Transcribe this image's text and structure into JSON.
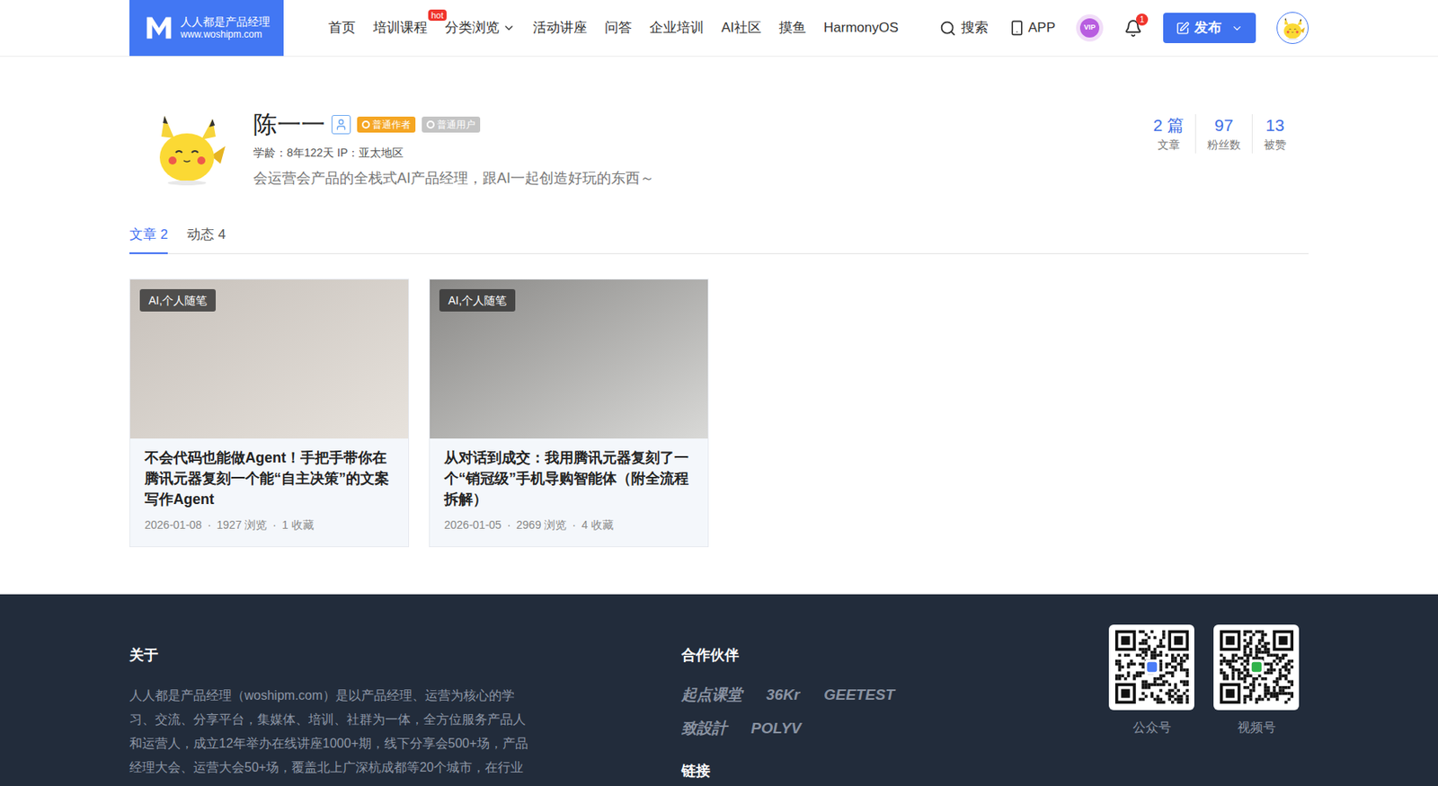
{
  "header": {
    "logo": {
      "title": "人人都是产品经理",
      "url": "www.woshipm.com"
    },
    "nav": [
      {
        "label": "首页",
        "badge": "",
        "dropdown": false
      },
      {
        "label": "培训课程",
        "badge": "hot",
        "dropdown": false
      },
      {
        "label": "分类浏览",
        "badge": "",
        "dropdown": true
      },
      {
        "label": "活动讲座",
        "badge": "",
        "dropdown": false
      },
      {
        "label": "问答",
        "badge": "",
        "dropdown": false
      },
      {
        "label": "企业培训",
        "badge": "",
        "dropdown": false
      },
      {
        "label": "AI社区",
        "badge": "",
        "dropdown": false
      },
      {
        "label": "摸鱼",
        "badge": "",
        "dropdown": false
      },
      {
        "label": "HarmonyOS",
        "badge": "",
        "dropdown": false
      }
    ],
    "search": "搜索",
    "app": "APP",
    "vip": "VIP",
    "notifications": "1",
    "publish": "发布"
  },
  "profile": {
    "name": "陈一一",
    "badges": [
      {
        "label": "普通作者",
        "color": "#f5a623"
      },
      {
        "label": "普通用户",
        "color": "#c4c4c4"
      }
    ],
    "meta": "学龄：8年122天 IP：亚太地区",
    "bio": "会运营会产品的全栈式AI产品经理，跟AI一起创造好玩的东西～",
    "stats": [
      {
        "value": "2 篇",
        "label": "文章"
      },
      {
        "value": "97",
        "label": "粉丝数"
      },
      {
        "value": "13",
        "label": "被赞"
      }
    ]
  },
  "tabs": [
    {
      "label": "文章 2",
      "selected": true
    },
    {
      "label": "动态 4",
      "selected": false
    }
  ],
  "articles": [
    {
      "tag": "AI,个人随笔",
      "title": "不会代码也能做Agent！手把手带你在腾讯元器复刻一个能“自主决策”的文案写作Agent",
      "date": "2026-01-08",
      "views": "1927 浏览",
      "favorites": "1 收藏"
    },
    {
      "tag": "AI,个人随笔",
      "title": "从对话到成交：我用腾讯元器复刻了一个“销冠级”手机导购智能体（附全流程拆解）",
      "date": "2026-01-05",
      "views": "2969 浏览",
      "favorites": "4 收藏"
    }
  ],
  "separator": "·",
  "footer": {
    "about": {
      "title": "关于",
      "lines": [
        "人人都是产品经理（woshipm.com）是以产品经理、运营为核心的学",
        "习、交流、分享平台，集媒体、培训、社群为一体，全方位服务产品人",
        "和运营人，成立12年举办在线讲座1000+期，线下分享会500+场，产品",
        "经理大会、运营大会50+场，覆盖北上广深杭成都等20个城市，在行业"
      ]
    },
    "partners": {
      "title": "合作伙伴",
      "logos": [
        "起点课堂",
        "36Kr",
        "GEETEST",
        "致設計",
        "POLYV"
      ]
    },
    "links": {
      "title": "链接"
    },
    "qrcodes": [
      {
        "label": "公众号",
        "color": "#4a7cf7"
      },
      {
        "label": "视频号",
        "color": "#2fb34a"
      }
    ]
  }
}
